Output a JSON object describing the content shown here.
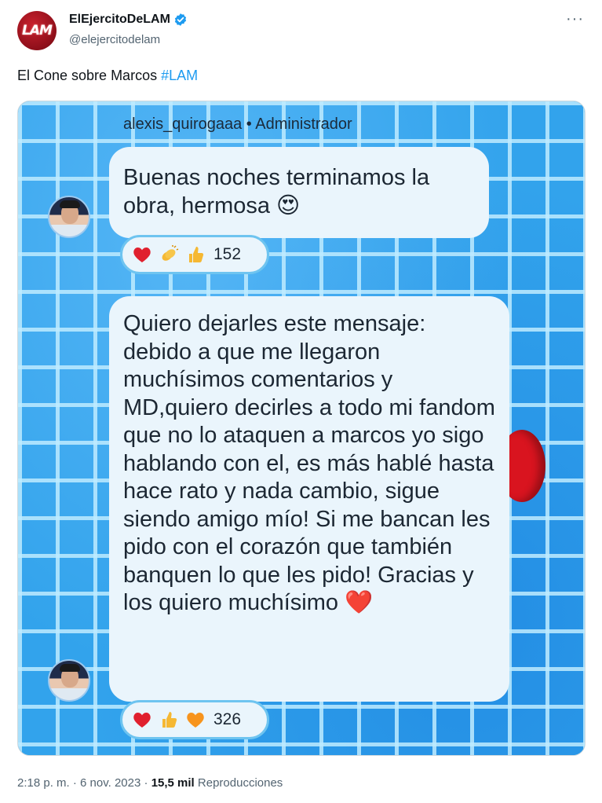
{
  "account": {
    "display_name": "ElEjercitoDeLAM",
    "handle": "@elejercitodelam",
    "avatar_text": "LAM",
    "verified": true,
    "more_label": "···"
  },
  "tweet": {
    "text": "El Cone sobre Marcos ",
    "hashtag": "#LAM"
  },
  "screenshot": {
    "sender": "alexis_quirogaaa • Administrador",
    "messages": [
      {
        "text": "Buenas noches terminamos la obra, hermosa 😍",
        "reactions": [
          "heart",
          "clap",
          "thumbs-up"
        ],
        "count": "152"
      },
      {
        "text": "Quiero dejarles este mensaje: debido a que me llegaron muchísimos comentarios y MD,quiero decirles a todo mi fandom que no lo ataquen a marcos yo sigo hablando con el, es más hablé hasta hace rato y nada cambio, sigue siendo amigo mío! Si me bancan les pido con el corazón que también banquen lo que les pido! Gracias y los quiero muchísimo ❤️",
        "reactions": [
          "heart",
          "thumbs-up",
          "orange-heart"
        ],
        "count": "326"
      }
    ]
  },
  "footer": {
    "time": "2:18 p. m.",
    "separator": " · ",
    "date": "6 nov. 2023",
    "views": "15,5 mil",
    "views_label": " Reproducciones"
  },
  "colors": {
    "link": "#1d9bf0",
    "verified": "#1d9bf0",
    "pool": "#32a3ec",
    "bubble": "#eaf5fc"
  }
}
